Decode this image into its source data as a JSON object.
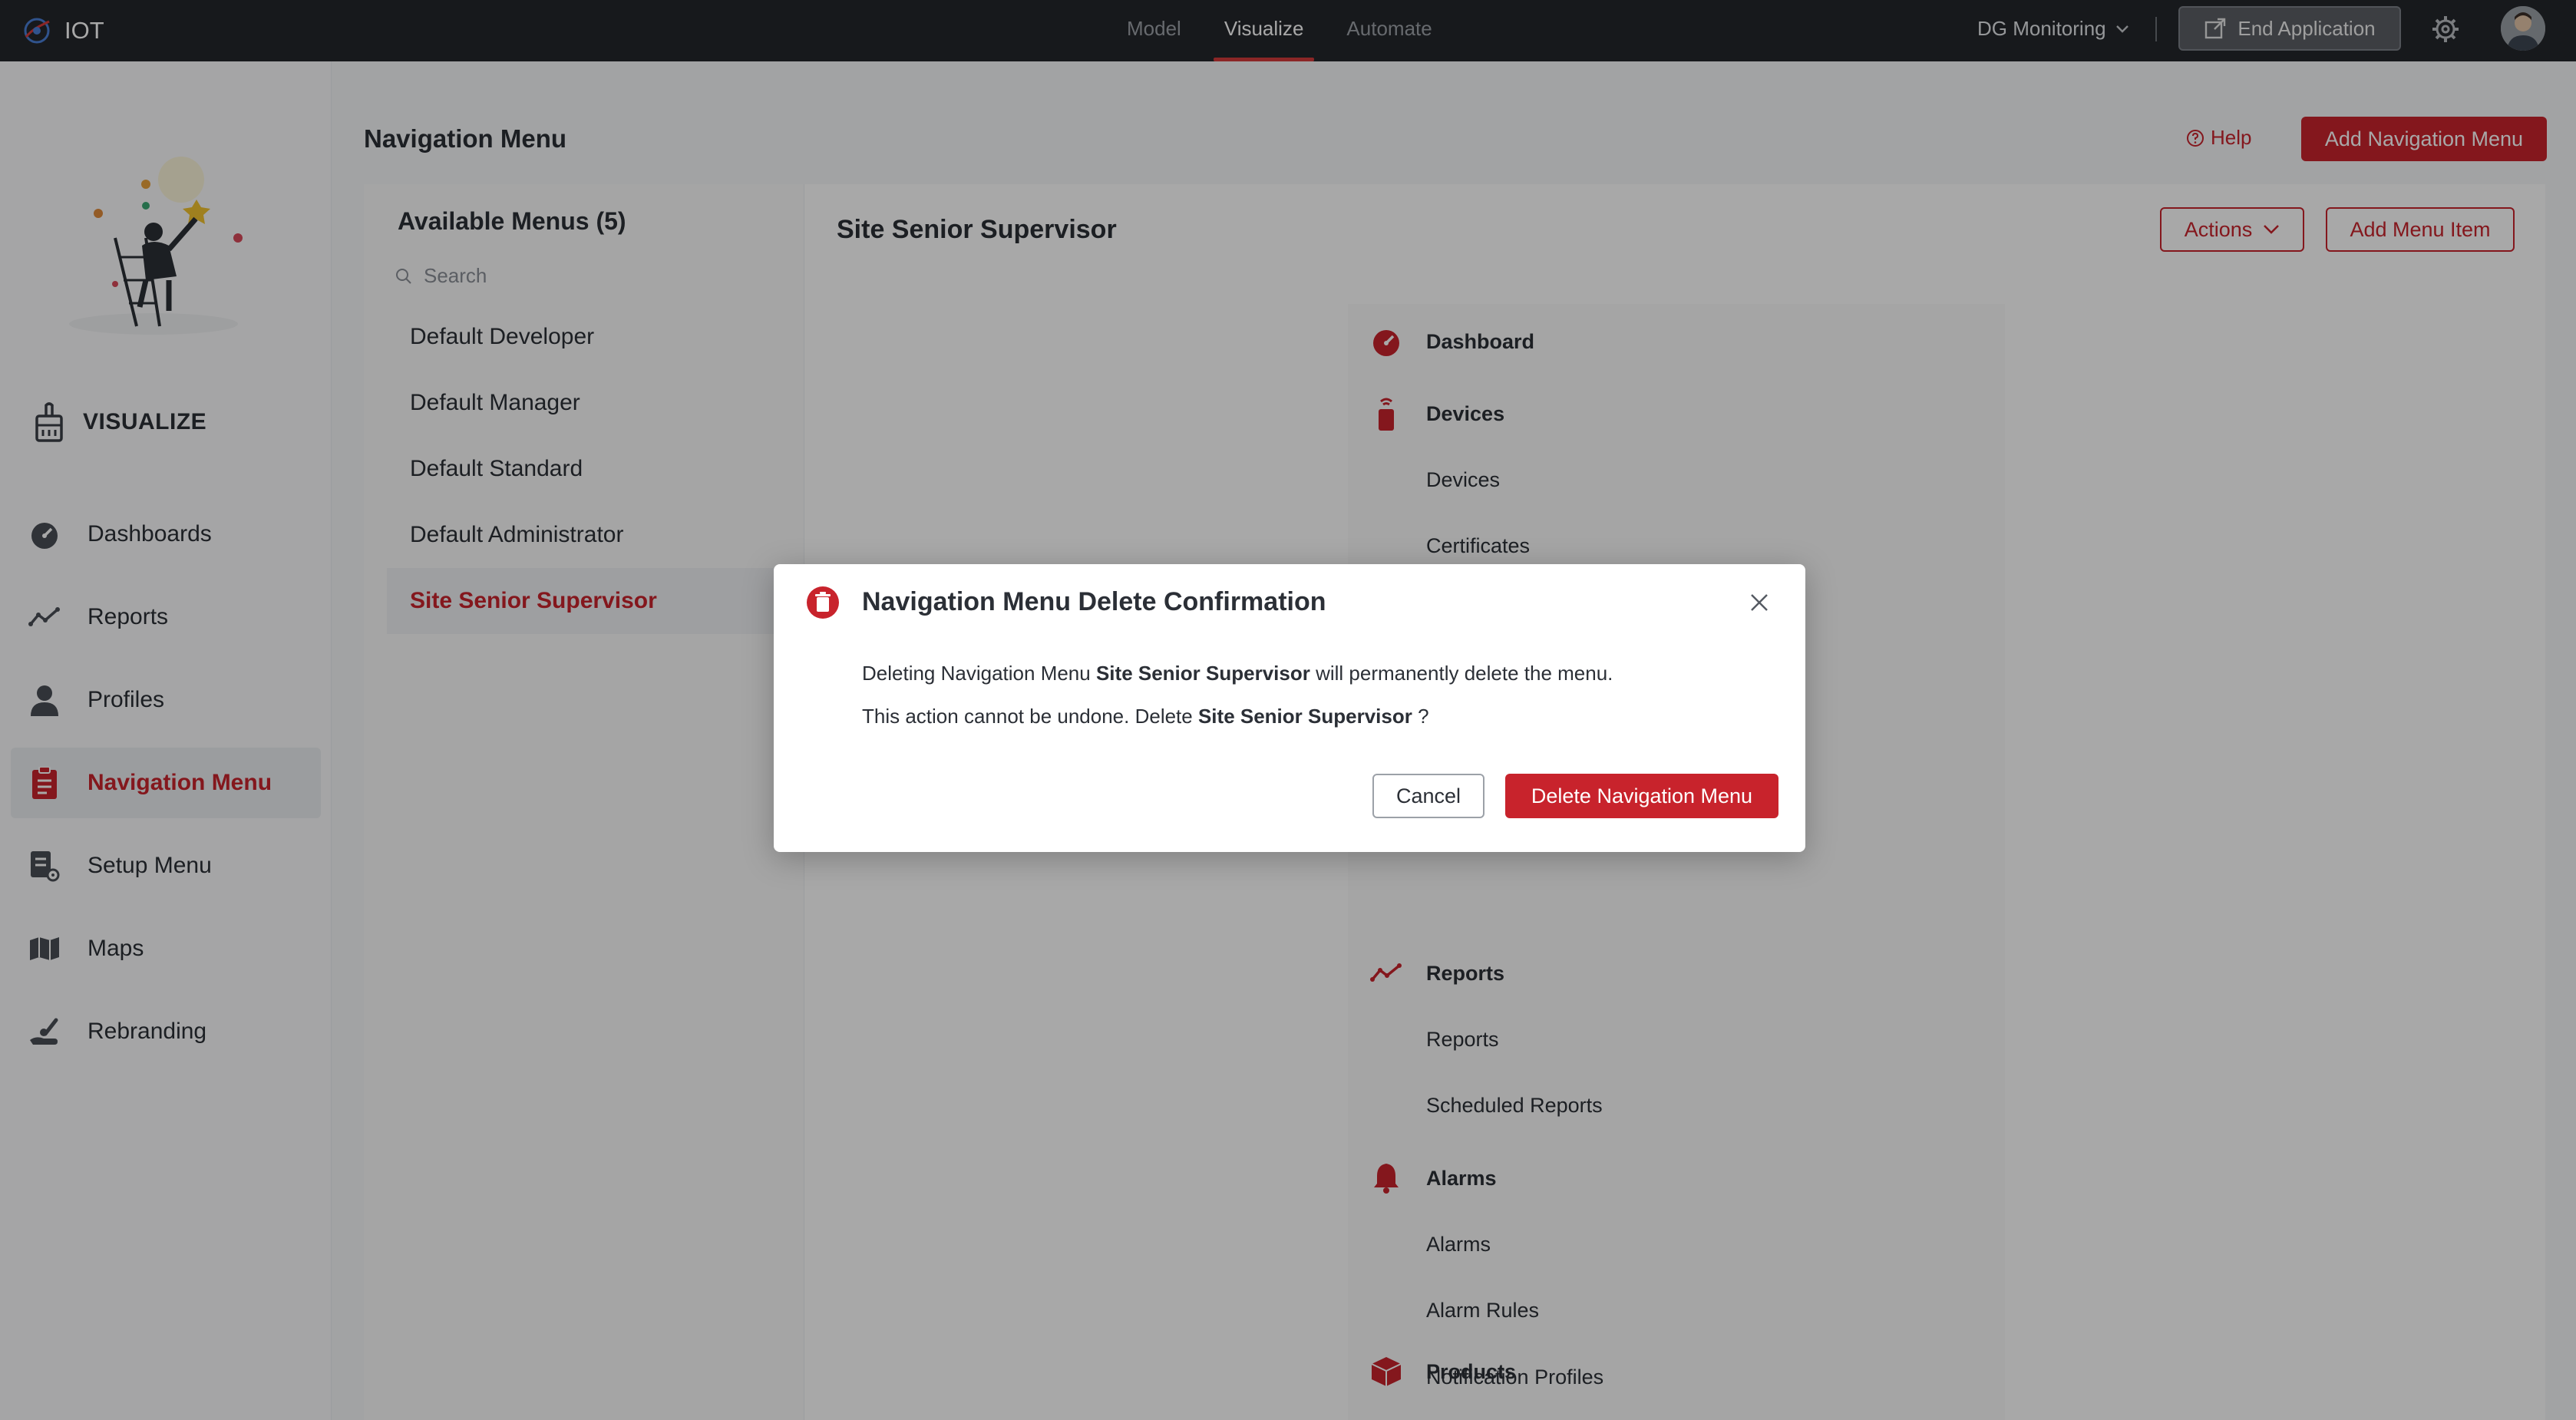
{
  "topbar": {
    "brand": "IOT",
    "tabs": [
      "Model",
      "Visualize",
      "Automate"
    ],
    "active_tab": "Visualize",
    "app_name": "DG Monitoring",
    "end_app_label": "End Application"
  },
  "sidebar": {
    "section_label": "VISUALIZE",
    "items": [
      {
        "label": "Dashboards",
        "icon": "speedometer-icon"
      },
      {
        "label": "Reports",
        "icon": "trend-line-icon"
      },
      {
        "label": "Profiles",
        "icon": "user-icon"
      },
      {
        "label": "Navigation Menu",
        "icon": "clipboard-list-icon",
        "active": true
      },
      {
        "label": "Setup Menu",
        "icon": "setup-list-icon"
      },
      {
        "label": "Maps",
        "icon": "map-icon"
      },
      {
        "label": "Rebranding",
        "icon": "hand-brush-icon"
      }
    ]
  },
  "page": {
    "title": "Navigation Menu",
    "help_label": "Help",
    "add_navigation_label": "Add Navigation Menu"
  },
  "menus": {
    "title": "Available Menus (5)",
    "search_placeholder": "Search",
    "items": [
      "Default Developer",
      "Default Manager",
      "Default Standard",
      "Default Administrator",
      "Site Senior Supervisor"
    ],
    "active": "Site Senior Supervisor"
  },
  "detail": {
    "title": "Site Senior Supervisor",
    "actions_label": "Actions",
    "add_item_label": "Add Menu Item",
    "tree": [
      {
        "label": "Dashboard",
        "parent": true,
        "icon": "speedometer-icon"
      },
      {
        "label": "Devices",
        "parent": true,
        "icon": "device-icon"
      },
      {
        "label": "Devices",
        "parent": false
      },
      {
        "label": "Certificates",
        "parent": false
      },
      {
        "label": "Reports",
        "parent": true,
        "icon": "trend-line-icon"
      },
      {
        "label": "Reports",
        "parent": false
      },
      {
        "label": "Scheduled Reports",
        "parent": false
      },
      {
        "label": "Alarms",
        "parent": true,
        "icon": "bell-icon"
      },
      {
        "label": "Alarms",
        "parent": false
      },
      {
        "label": "Alarm Rules",
        "parent": false
      },
      {
        "label": "Notification Profiles",
        "parent": false
      },
      {
        "label": "Products",
        "parent": true,
        "icon": "box-icon"
      }
    ]
  },
  "modal": {
    "title": "Navigation Menu Delete Confirmation",
    "line1_pre": "Deleting Navigation Menu ",
    "line1_bold": "Site Senior Supervisor",
    "line1_post": " will permanently delete the menu.",
    "line2_pre": "This action cannot be undone. Delete ",
    "line2_bold": "Site Senior Supervisor",
    "line2_post": " ?",
    "cancel_label": "Cancel",
    "delete_label": "Delete Navigation Menu"
  },
  "colors": {
    "accent": "#c8232c",
    "topbar": "#24262b"
  }
}
